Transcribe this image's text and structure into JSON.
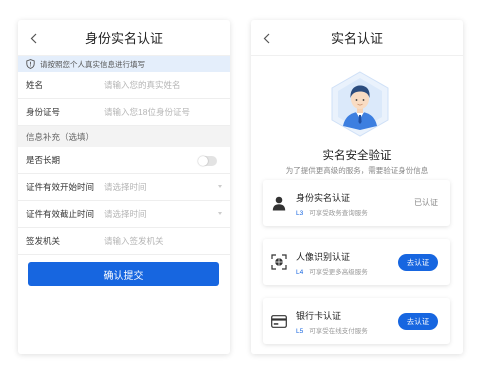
{
  "colors": {
    "primary": "#1766e0",
    "notice_bg": "#e4eefb",
    "section_bg": "#f3f3f3"
  },
  "left_screen": {
    "title": "身份实名认证",
    "back_icon": "chevron-left-icon",
    "notice": {
      "icon": "shield-icon",
      "text": "请按照您个人真实信息进行填写"
    },
    "fields": [
      {
        "label": "姓名",
        "placeholder": "请输入您的真实姓名"
      },
      {
        "label": "身份证号",
        "placeholder": "请输入您18位身份证号"
      }
    ],
    "section_title": "信息补充（选填）",
    "long_term": {
      "label": "是否长期",
      "checked": false
    },
    "extra_fields": [
      {
        "label": "证件有效开始时间",
        "placeholder": "请选择时间"
      },
      {
        "label": "证件有效截止时间",
        "placeholder": "请选择时间"
      },
      {
        "label": "签发机关",
        "placeholder": "请输入签发机关"
      }
    ],
    "submit_label": "确认提交"
  },
  "right_screen": {
    "title": "实名认证",
    "back_icon": "chevron-left-icon",
    "hero_icon": "user-avatar-hexagon-icon",
    "headline": "实名安全验证",
    "subline": "为了提供更高级的服务，需要验证身份信息",
    "cards": [
      {
        "icon": "person-icon",
        "name": "身份实名认证",
        "level": "L3",
        "desc": "可享受政务查询服务",
        "status": "已认证"
      },
      {
        "icon": "face-scan-icon",
        "name": "人像识别认证",
        "level": "L4",
        "desc": "可享受更多高级服务",
        "action": "去认证"
      },
      {
        "icon": "bank-card-icon",
        "name": "银行卡认证",
        "level": "L5",
        "desc": "可享受在线支付服务",
        "action": "去认证"
      }
    ]
  }
}
